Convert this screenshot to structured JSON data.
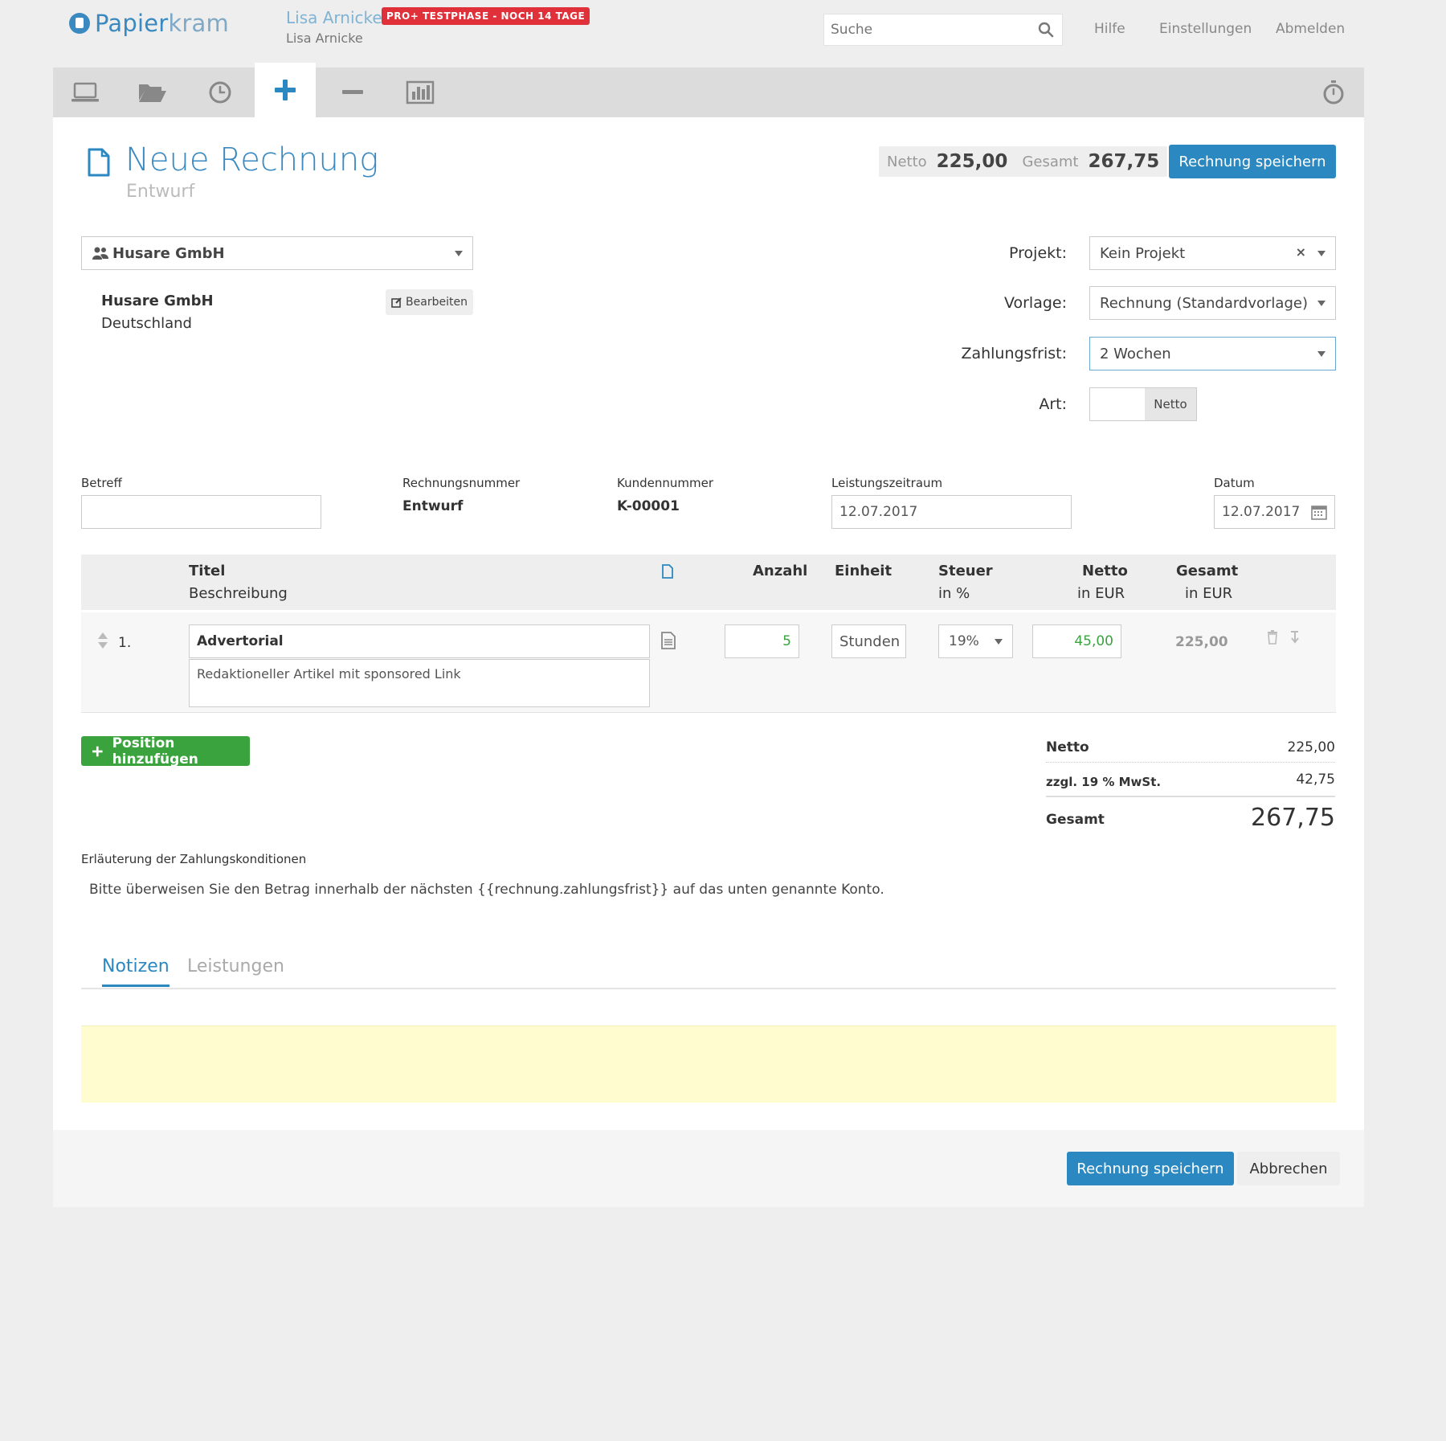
{
  "brand": {
    "name_a": "Papier",
    "name_b": "kram",
    "accent": "#2b88c0"
  },
  "user": {
    "name": "Lisa Arnicke",
    "sub": "Lisa Arnicke",
    "trial": "PRO+ TESTPHASE - NOCH 14 TAGE"
  },
  "search": {
    "placeholder": "Suche"
  },
  "topnav": {
    "help": "Hilfe",
    "settings": "Einstellungen",
    "logout": "Abmelden"
  },
  "page": {
    "title": "Neue Rechnung",
    "status": "Entwurf"
  },
  "totals": {
    "netto_label": "Netto",
    "netto": "225,00",
    "gesamt_label": "Gesamt",
    "gesamt": "267,75"
  },
  "actions": {
    "save": "Rechnung speichern",
    "cancel": "Abbrechen"
  },
  "customer": {
    "select": "Husare GmbH",
    "name": "Husare GmbH",
    "country": "Deutschland",
    "edit": "Bearbeiten"
  },
  "settings": {
    "project_label": "Projekt:",
    "project": "Kein Projekt",
    "template_label": "Vorlage:",
    "template": "Rechnung (Standardvorlage)",
    "due_label": "Zahlungsfrist:",
    "due": "2 Wochen",
    "type_label": "Art:",
    "type": "Netto"
  },
  "meta": {
    "subject_label": "Betreff",
    "subject": "",
    "number_label": "Rechnungsnummer",
    "number": "Entwurf",
    "customer_no_label": "Kundennummer",
    "customer_no": "K-00001",
    "period_label": "Leistungszeitraum",
    "period": "12.07.2017",
    "date_label": "Datum",
    "date": "12.07.2017"
  },
  "table": {
    "title": "Titel",
    "description": "Beschreibung",
    "quantity": "Anzahl",
    "unit": "Einheit",
    "tax": "Steuer",
    "tax_sub": "in %",
    "net": "Netto",
    "net_sub": "in EUR",
    "total": "Gesamt",
    "total_sub": "in EUR"
  },
  "items": [
    {
      "pos": "1.",
      "title": "Advertorial",
      "description": "Redaktioneller Artikel mit sponsored Link",
      "quantity": "5",
      "unit": "Stunden",
      "tax": "19%",
      "net": "45,00",
      "total": "225,00"
    }
  ],
  "add_position": "Position hinzufügen",
  "summary": {
    "net_label": "Netto",
    "net": "225,00",
    "vat_label": "zzgl. 19 % MwSt.",
    "vat": "42,75",
    "total_label": "Gesamt",
    "total": "267,75"
  },
  "payment": {
    "label": "Erläuterung der Zahlungskonditionen",
    "text": "Bitte überweisen Sie den Betrag innerhalb der nächsten {{rechnung.zahlungsfrist}} auf das unten genannte Konto."
  },
  "tabs": {
    "notes": "Notizen",
    "services": "Leistungen"
  }
}
